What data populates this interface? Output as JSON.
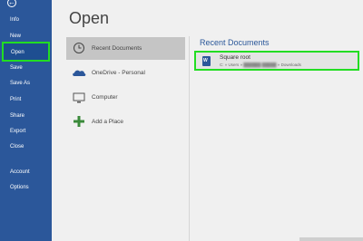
{
  "nav": {
    "items": [
      {
        "label": "Info"
      },
      {
        "label": "New"
      },
      {
        "label": "Open"
      },
      {
        "label": "Save"
      },
      {
        "label": "Save As"
      },
      {
        "label": "Print"
      },
      {
        "label": "Share"
      },
      {
        "label": "Export"
      },
      {
        "label": "Close"
      },
      {
        "label": "Account"
      },
      {
        "label": "Options"
      }
    ]
  },
  "page": {
    "title": "Open"
  },
  "locations": [
    {
      "label": "Recent Documents",
      "icon": "clock-icon",
      "selected": true
    },
    {
      "label": "OneDrive - Personal",
      "icon": "onedrive-icon"
    },
    {
      "label": "Computer",
      "icon": "computer-icon"
    },
    {
      "label": "Add a Place",
      "icon": "plus-icon"
    }
  ],
  "recent": {
    "title": "Recent Documents",
    "items": [
      {
        "name": "Square root",
        "path_prefix": "C: » Users » ",
        "path_suffix": " » Downloads",
        "icon_letter": "W"
      }
    ]
  },
  "colors": {
    "accent": "#2b579a",
    "highlight": "#22dd22"
  }
}
